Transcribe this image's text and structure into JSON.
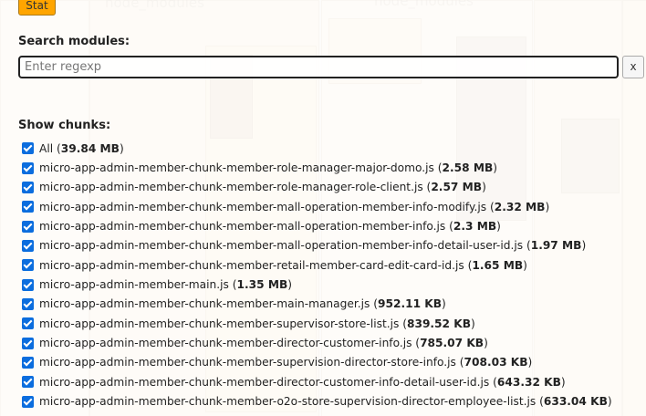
{
  "toolbar": {
    "stat_label": "Stat"
  },
  "search": {
    "label": "Search modules:",
    "placeholder": "Enter regexp",
    "value": "",
    "clear_label": "x"
  },
  "chunks": {
    "label": "Show chunks:",
    "checked_color": "#0b6dde",
    "items": [
      {
        "name": "All",
        "size": "39.84 MB",
        "checked": true
      },
      {
        "name": "micro-app-admin-member-chunk-member-role-manager-major-domo.js",
        "size": "2.58 MB",
        "checked": true
      },
      {
        "name": "micro-app-admin-member-chunk-member-role-manager-role-client.js",
        "size": "2.57 MB",
        "checked": true
      },
      {
        "name": "micro-app-admin-member-chunk-member-mall-operation-member-info-modify.js",
        "size": "2.32 MB",
        "checked": true
      },
      {
        "name": "micro-app-admin-member-chunk-member-mall-operation-member-info.js",
        "size": "2.3 MB",
        "checked": true
      },
      {
        "name": "micro-app-admin-member-chunk-member-mall-operation-member-info-detail-user-id.js",
        "size": "1.97 MB",
        "checked": true
      },
      {
        "name": "micro-app-admin-member-chunk-member-retail-member-card-edit-card-id.js",
        "size": "1.65 MB",
        "checked": true
      },
      {
        "name": "micro-app-admin-member-main.js",
        "size": "1.35 MB",
        "checked": true
      },
      {
        "name": "micro-app-admin-member-chunk-member-main-manager.js",
        "size": "952.11 KB",
        "checked": true
      },
      {
        "name": "micro-app-admin-member-chunk-member-supervisor-store-list.js",
        "size": "839.52 KB",
        "checked": true
      },
      {
        "name": "micro-app-admin-member-chunk-member-director-customer-info.js",
        "size": "785.07 KB",
        "checked": true
      },
      {
        "name": "micro-app-admin-member-chunk-member-supervision-director-store-info.js",
        "size": "708.03 KB",
        "checked": true
      },
      {
        "name": "micro-app-admin-member-chunk-member-director-customer-info-detail-user-id.js",
        "size": "643.32 KB",
        "checked": true
      },
      {
        "name": "micro-app-admin-member-chunk-member-o2o-store-supervision-director-employee-list.js",
        "size": "633.04 KB",
        "checked": true
      }
    ]
  }
}
